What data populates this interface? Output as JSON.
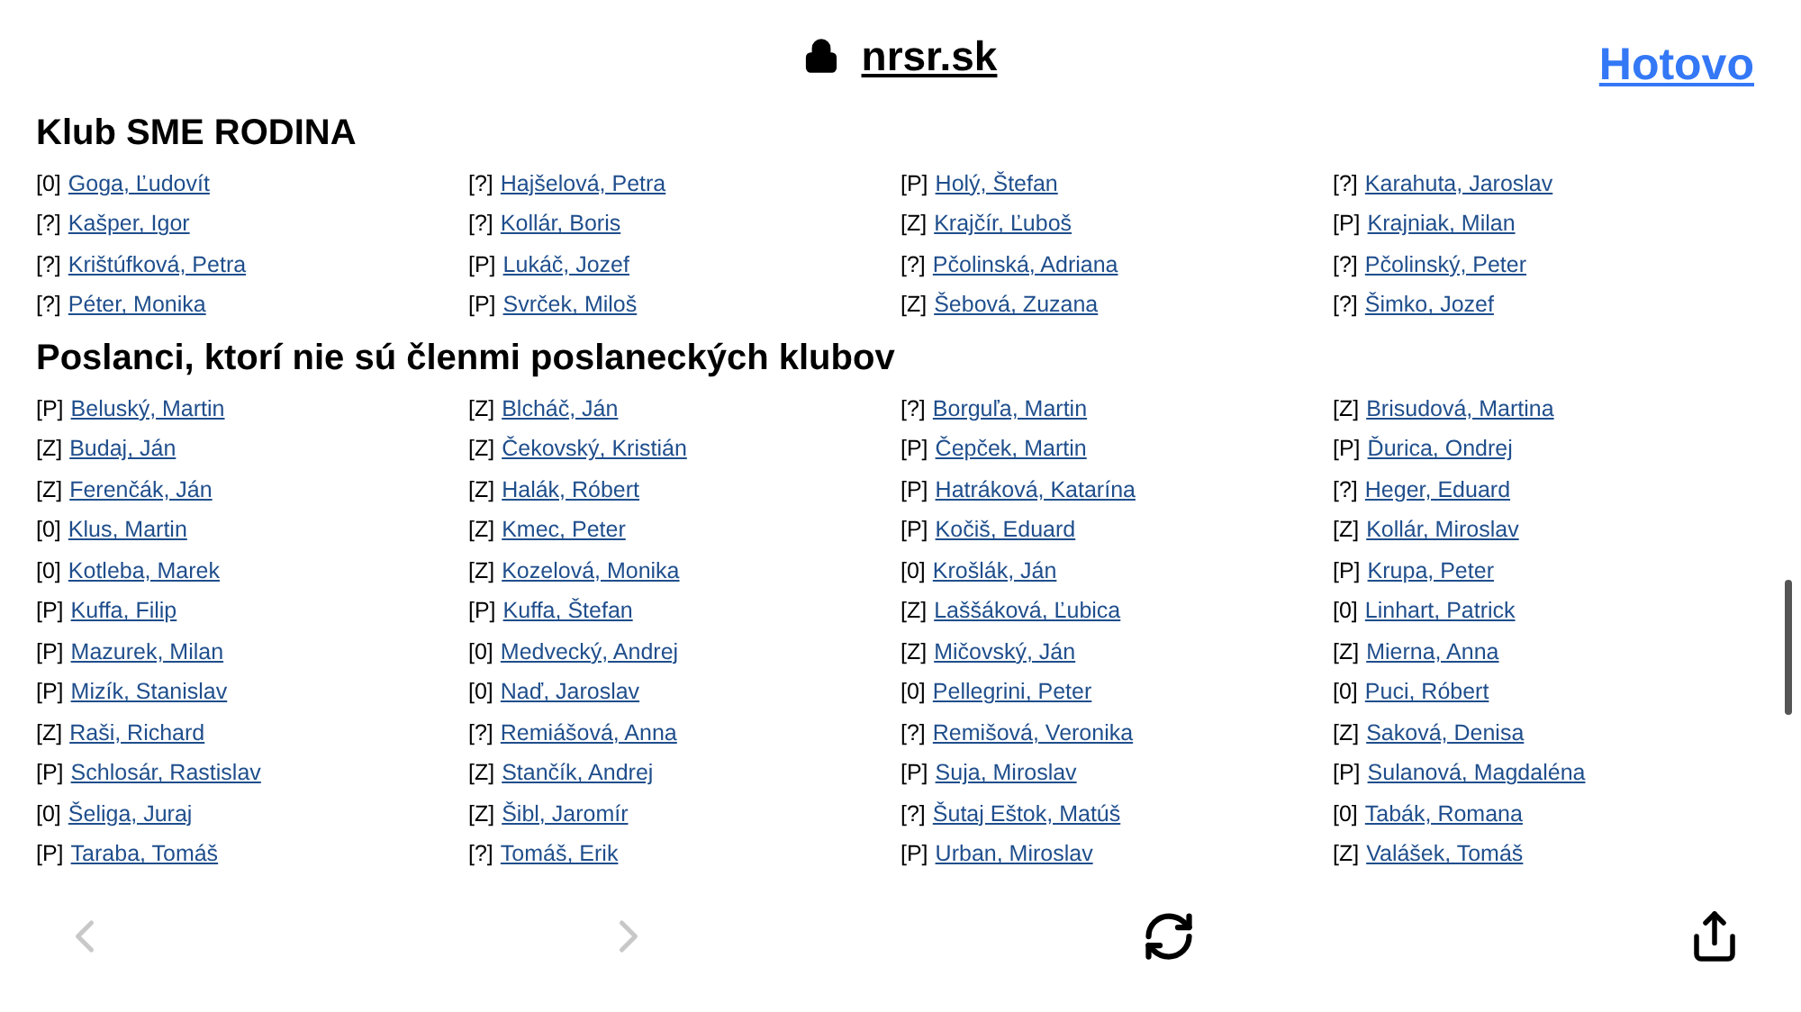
{
  "address_bar": {
    "domain": "nrsr.sk",
    "done_button": "Hotovo"
  },
  "sections": [
    {
      "title": "Klub SME RODINA",
      "members": [
        {
          "tag": "[0]",
          "name": "Goga, Ľudovít"
        },
        {
          "tag": "[?]",
          "name": "Hajšelová, Petra"
        },
        {
          "tag": "[P]",
          "name": "Holý, Štefan"
        },
        {
          "tag": "[?]",
          "name": "Karahuta, Jaroslav"
        },
        {
          "tag": "[?]",
          "name": "Kašper, Igor"
        },
        {
          "tag": "[?]",
          "name": "Kollár, Boris"
        },
        {
          "tag": "[Z]",
          "name": "Krajčír, Ľuboš"
        },
        {
          "tag": "[P]",
          "name": "Krajniak, Milan"
        },
        {
          "tag": "[?]",
          "name": "Krištúfková, Petra"
        },
        {
          "tag": "[P]",
          "name": "Lukáč, Jozef"
        },
        {
          "tag": "[?]",
          "name": "Pčolinská, Adriana"
        },
        {
          "tag": "[?]",
          "name": "Pčolinský, Peter"
        },
        {
          "tag": "[?]",
          "name": "Péter, Monika"
        },
        {
          "tag": "[P]",
          "name": "Svrček, Miloš"
        },
        {
          "tag": "[Z]",
          "name": "Šebová, Zuzana"
        },
        {
          "tag": "[?]",
          "name": "Šimko, Jozef"
        }
      ]
    },
    {
      "title": "Poslanci, ktorí nie sú členmi poslaneckých klubov",
      "members": [
        {
          "tag": "[P]",
          "name": "Beluský, Martin"
        },
        {
          "tag": "[Z]",
          "name": "Blcháč, Ján"
        },
        {
          "tag": "[?]",
          "name": "Borguľa, Martin"
        },
        {
          "tag": "[Z]",
          "name": "Brisudová, Martina"
        },
        {
          "tag": "[Z]",
          "name": "Budaj, Ján"
        },
        {
          "tag": "[Z]",
          "name": "Čekovský, Kristián"
        },
        {
          "tag": "[P]",
          "name": "Čepček, Martin"
        },
        {
          "tag": "[P]",
          "name": "Ďurica, Ondrej"
        },
        {
          "tag": "[Z]",
          "name": "Ferenčák, Ján"
        },
        {
          "tag": "[Z]",
          "name": "Halák, Róbert"
        },
        {
          "tag": "[P]",
          "name": "Hatráková, Katarína"
        },
        {
          "tag": "[?]",
          "name": "Heger, Eduard"
        },
        {
          "tag": "[0]",
          "name": "Klus, Martin"
        },
        {
          "tag": "[Z]",
          "name": "Kmec, Peter"
        },
        {
          "tag": "[P]",
          "name": "Kočiš, Eduard"
        },
        {
          "tag": "[Z]",
          "name": "Kollár, Miroslav"
        },
        {
          "tag": "[0]",
          "name": "Kotleba, Marek"
        },
        {
          "tag": "[Z]",
          "name": "Kozelová, Monika"
        },
        {
          "tag": "[0]",
          "name": "Krošlák, Ján"
        },
        {
          "tag": "[P]",
          "name": "Krupa, Peter"
        },
        {
          "tag": "[P]",
          "name": "Kuffa, Filip"
        },
        {
          "tag": "[P]",
          "name": "Kuffa, Štefan"
        },
        {
          "tag": "[Z]",
          "name": "Laššáková, Ľubica"
        },
        {
          "tag": "[0]",
          "name": "Linhart, Patrick"
        },
        {
          "tag": "[P]",
          "name": "Mazurek, Milan"
        },
        {
          "tag": "[0]",
          "name": "Medvecký, Andrej"
        },
        {
          "tag": "[Z]",
          "name": "Mičovský, Ján"
        },
        {
          "tag": "[Z]",
          "name": "Mierna, Anna"
        },
        {
          "tag": "[P]",
          "name": "Mizík, Stanislav"
        },
        {
          "tag": "[0]",
          "name": "Naď, Jaroslav"
        },
        {
          "tag": "[0]",
          "name": "Pellegrini, Peter"
        },
        {
          "tag": "[0]",
          "name": "Puci, Róbert"
        },
        {
          "tag": "[Z]",
          "name": "Raši, Richard"
        },
        {
          "tag": "[?]",
          "name": "Remiášová, Anna"
        },
        {
          "tag": "[?]",
          "name": "Remišová, Veronika"
        },
        {
          "tag": "[Z]",
          "name": "Saková, Denisa"
        },
        {
          "tag": "[P]",
          "name": "Schlosár, Rastislav"
        },
        {
          "tag": "[Z]",
          "name": "Stančík, Andrej"
        },
        {
          "tag": "[P]",
          "name": "Suja, Miroslav"
        },
        {
          "tag": "[P]",
          "name": "Sulanová, Magdaléna"
        },
        {
          "tag": "[0]",
          "name": "Šeliga, Juraj"
        },
        {
          "tag": "[Z]",
          "name": "Šibl, Jaromír"
        },
        {
          "tag": "[?]",
          "name": "Šutaj Eštok, Matúš"
        },
        {
          "tag": "[0]",
          "name": "Tabák, Romana"
        },
        {
          "tag": "[P]",
          "name": "Taraba, Tomáš"
        },
        {
          "tag": "[?]",
          "name": "Tomáš, Erik"
        },
        {
          "tag": "[P]",
          "name": "Urban, Miroslav"
        },
        {
          "tag": "[Z]",
          "name": "Valášek, Tomáš"
        }
      ]
    }
  ],
  "toolbar": {
    "back_disabled": true,
    "forward_disabled": true
  }
}
